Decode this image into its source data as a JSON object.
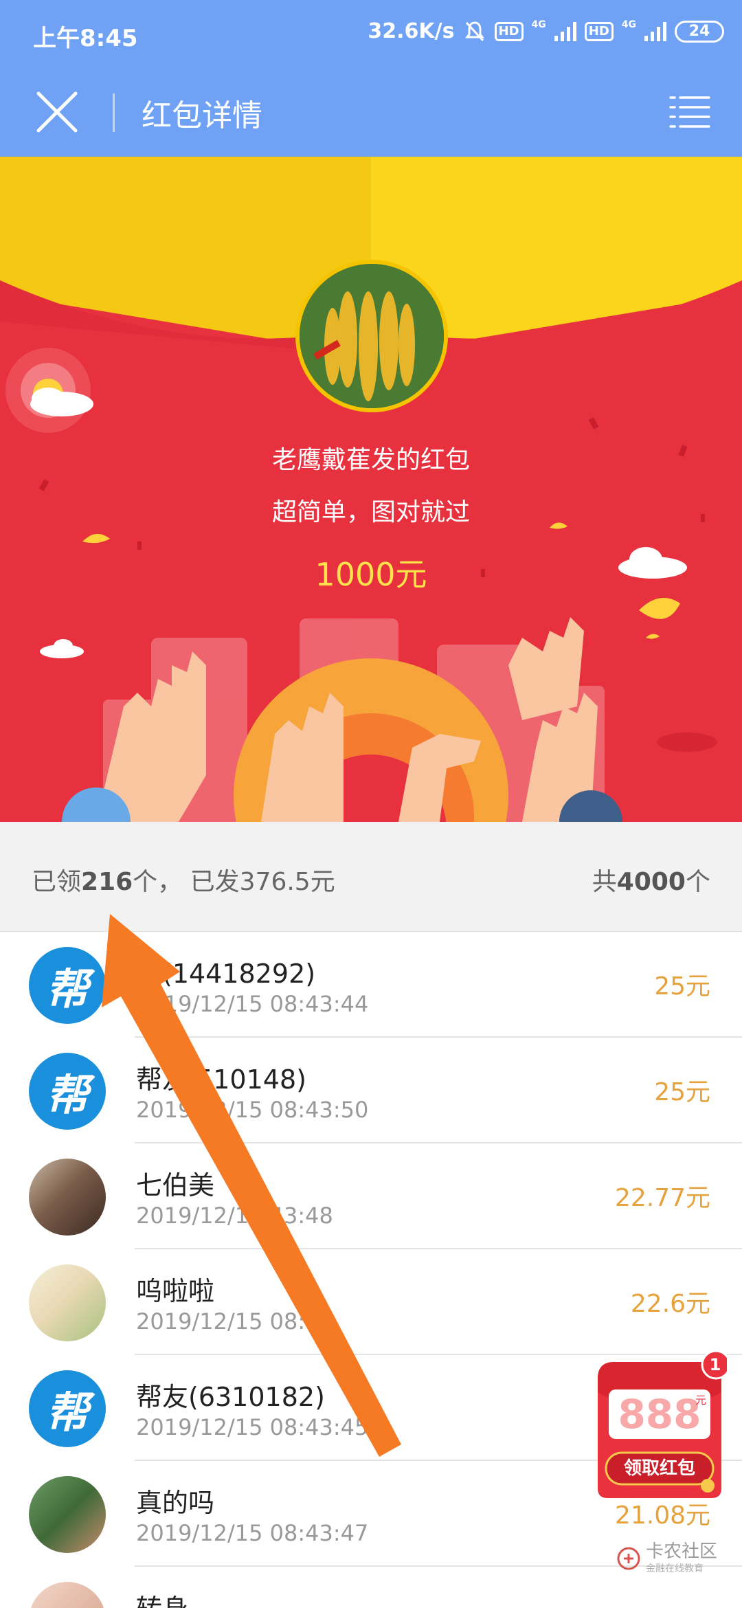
{
  "status_bar": {
    "time": "上午8:45",
    "net_speed": "32.6K/s",
    "hd1": "HD",
    "sig1": "4G",
    "hd2": "HD",
    "sig2": "4G",
    "battery": "24"
  },
  "nav": {
    "title": "红包详情",
    "close_icon": "close-icon",
    "menu_icon": "menu-icon"
  },
  "banner": {
    "sender": "老鹰戴萑发的红包",
    "greeting": "超简单，图对就过",
    "amount": "1000元"
  },
  "summary": {
    "claimed_prefix": "已领",
    "claimed_count": "216",
    "claimed_suffix": "个，",
    "sent_label": " 已发376.5元",
    "total_prefix": "共",
    "total_count": "4000",
    "total_suffix": "个"
  },
  "records": [
    {
      "name": "友(14418292)",
      "time": "2019/12/15 08:43:44",
      "amount": "25元",
      "avatar": "bang"
    },
    {
      "name": "帮友 510148)",
      "time": "2019/12/15 08:43:50",
      "amount": "25元",
      "avatar": "bang"
    },
    {
      "name": "七伯美",
      "time": "2019/12/15 43:48",
      "amount": "22.77元",
      "avatar": "photo"
    },
    {
      "name": "呜啦啦",
      "time": "2019/12/15 08:43.",
      "amount": "22.6元",
      "avatar": "photo"
    },
    {
      "name": "帮友(6310182)",
      "time": "2019/12/15 08:43:45",
      "amount": "",
      "avatar": "bang"
    },
    {
      "name": "真的吗",
      "time": "2019/12/15 08:43:47",
      "amount": "21.08元",
      "avatar": "photo"
    },
    {
      "name": "转身",
      "time": "",
      "amount": "",
      "avatar": "photo"
    }
  ],
  "float_redpacket": {
    "badge": "1",
    "value": "888",
    "unit": "元",
    "button": "领取红包"
  },
  "watermark": {
    "text": "卡农社区",
    "sub": "金融在线教育"
  },
  "colors": {
    "nav_blue": "#6fa2f4",
    "banner_red": "#e8313f",
    "amount_yellow": "#ffe34a",
    "money_orange": "#e6a23c",
    "arrow_orange": "#f67a24"
  }
}
